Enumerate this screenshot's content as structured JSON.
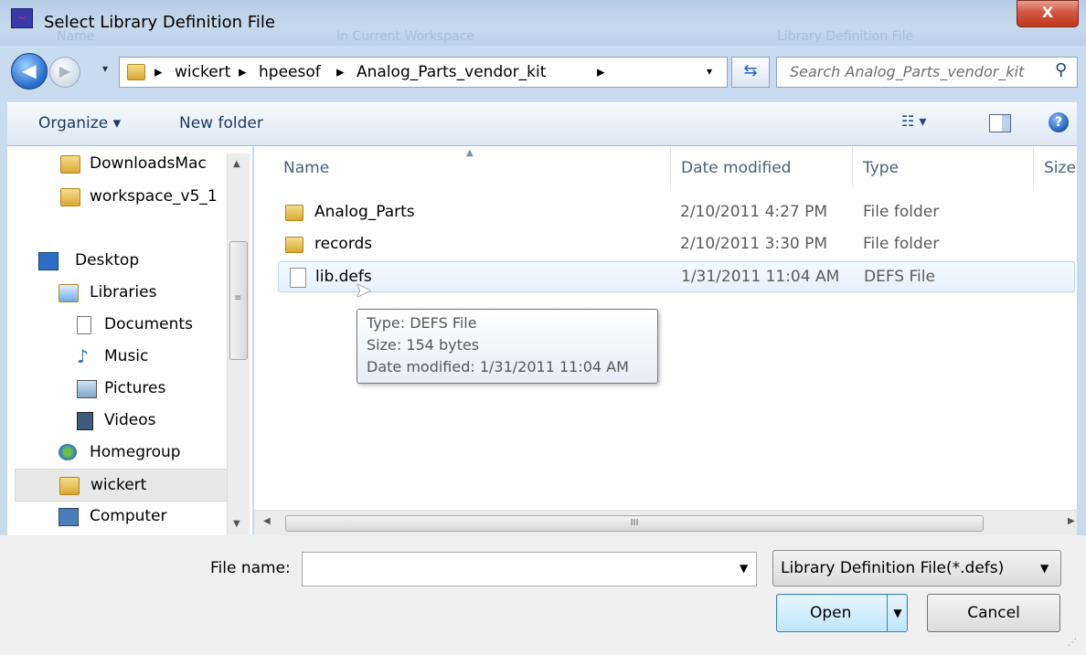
{
  "window": {
    "title": "Select Library Definition File",
    "close_label": "X",
    "ghost_headers": [
      "Name",
      "In Current Workspace",
      "Library Definition File"
    ]
  },
  "nav": {
    "breadcrumbs": [
      "wickert",
      "hpeesof",
      "Analog_Parts_vendor_kit"
    ],
    "search_placeholder": "Search Analog_Parts_vendor_kit"
  },
  "toolbar": {
    "organize_label": "Organize ▾",
    "new_folder_label": "New folder",
    "views_label": "☷ ▾",
    "help_label": "?"
  },
  "sidebar": {
    "items": [
      {
        "label": "DownloadsMac",
        "icon": "folder-icon"
      },
      {
        "label": "workspace_v5_1",
        "icon": "folder-icon"
      },
      {
        "label": "Desktop",
        "icon": "desktop-icon"
      },
      {
        "label": "Libraries",
        "icon": "libraries-icon"
      },
      {
        "label": "Documents",
        "icon": "documents-icon"
      },
      {
        "label": "Music",
        "icon": "music-icon"
      },
      {
        "label": "Pictures",
        "icon": "pictures-icon"
      },
      {
        "label": "Videos",
        "icon": "videos-icon"
      },
      {
        "label": "Homegroup",
        "icon": "homegroup-icon"
      },
      {
        "label": "wickert",
        "icon": "user-folder-icon"
      },
      {
        "label": "Computer",
        "icon": "computer-icon"
      }
    ],
    "scroll_grip": "≡"
  },
  "columns": [
    "Name",
    "Date modified",
    "Type",
    "Size"
  ],
  "files": [
    {
      "name": "Analog_Parts",
      "date": "2/10/2011 4:27 PM",
      "type": "File folder",
      "icon": "folder-icon"
    },
    {
      "name": "records",
      "date": "2/10/2011 3:30 PM",
      "type": "File folder",
      "icon": "folder-icon"
    },
    {
      "name": "lib.defs",
      "date": "1/31/2011 11:04 AM",
      "type": "DEFS File",
      "icon": "file-icon"
    }
  ],
  "tooltip": {
    "type_line": "Type: DEFS File",
    "size_line": "Size: 154 bytes",
    "date_line": "Date modified: 1/31/2011 11:04 AM"
  },
  "hscroll_grip": "III",
  "bottom": {
    "filename_label": "File name:",
    "filename_value": "",
    "filetype_selected": "Library Definition File(*.defs)",
    "open_label": "Open",
    "cancel_label": "Cancel"
  },
  "colors": {
    "frame": "#c9dbee",
    "selection_border": "#b9d7f5",
    "accent_blue": "#2a6fd0"
  }
}
